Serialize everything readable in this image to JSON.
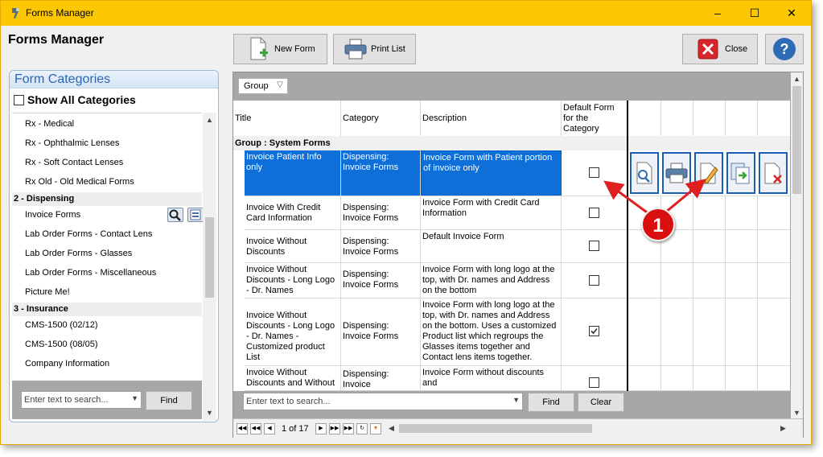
{
  "window": {
    "title": "Forms Manager",
    "controls": [
      "–",
      "☐",
      "✕"
    ]
  },
  "heading": "Forms Manager",
  "toolbar": {
    "new_form": "New Form",
    "print_list": "Print List",
    "close": "Close",
    "help": "?"
  },
  "categories": {
    "title": "Form Categories",
    "show_all": "Show All Categories",
    "items": [
      {
        "type": "item",
        "label": "Rx - Medical"
      },
      {
        "type": "item",
        "label": "Rx - Ophthalmic Lenses"
      },
      {
        "type": "item",
        "label": "Rx - Soft Contact Lenses"
      },
      {
        "type": "item",
        "label": "Rx Old - Old Medical Forms"
      },
      {
        "type": "group",
        "label": "2 - Dispensing"
      },
      {
        "type": "item",
        "label": "Invoice Forms"
      },
      {
        "type": "item",
        "label": "Lab Order Forms - Contact Lens"
      },
      {
        "type": "item",
        "label": "Lab Order Forms - Glasses"
      },
      {
        "type": "item",
        "label": "Lab Order Forms - Miscellaneous"
      },
      {
        "type": "item",
        "label": "Picture Me!"
      },
      {
        "type": "group",
        "label": "3 - Insurance"
      },
      {
        "type": "item",
        "label": "CMS-1500 (02/12)"
      },
      {
        "type": "item",
        "label": "CMS-1500 (08/05)"
      },
      {
        "type": "item",
        "label": "Company Information"
      }
    ],
    "search_placeholder": "Enter text to search...",
    "find": "Find"
  },
  "grid": {
    "group_chip": "Group",
    "columns": [
      "Title",
      "Category",
      "Description",
      "Default Form for the Category"
    ],
    "group_label": "Group : System Forms",
    "rows": [
      {
        "title": "Invoice Patient Info only",
        "category": "Dispensing: Invoice Forms",
        "description": "Invoice Form with  Patient portion of invoice only",
        "default": false,
        "selected": true
      },
      {
        "title": "Invoice With Credit Card Information",
        "category": "Dispensing: Invoice Forms",
        "description": "Invoice Form with Credit Card Information",
        "default": false
      },
      {
        "title": "Invoice Without Discounts",
        "category": "Dispensing: Invoice Forms",
        "description": "Default Invoice Form",
        "default": false
      },
      {
        "title": "Invoice Without Discounts - Long Logo - Dr. Names",
        "category": "Dispensing: Invoice Forms",
        "description": " Invoice Form with long logo at the top, with Dr. names  and Address on the bottom",
        "default": false
      },
      {
        "title": "Invoice Without Discounts - Long Logo - Dr. Names - Customized product List",
        "category": "Dispensing: Invoice Forms",
        "description": " Invoice Form with long logo at the top, with Dr. names  and Address on the bottom.  Uses a customized Product list which regroups the Glasses items together and Contact lens items together.",
        "default": true
      },
      {
        "title": "Invoice Without Discounts and Without",
        "category": "Dispensing: Invoice",
        "description": "Invoice Form  without discounts and",
        "default": false
      }
    ],
    "search_placeholder": "Enter text to search...",
    "find": "Find",
    "clear": "Clear",
    "pager_text": "1 of 17"
  },
  "callout": "1",
  "colors": {
    "titlebar": "#fbc602",
    "selection": "#0e6fd8",
    "callout": "#d90f0f"
  }
}
